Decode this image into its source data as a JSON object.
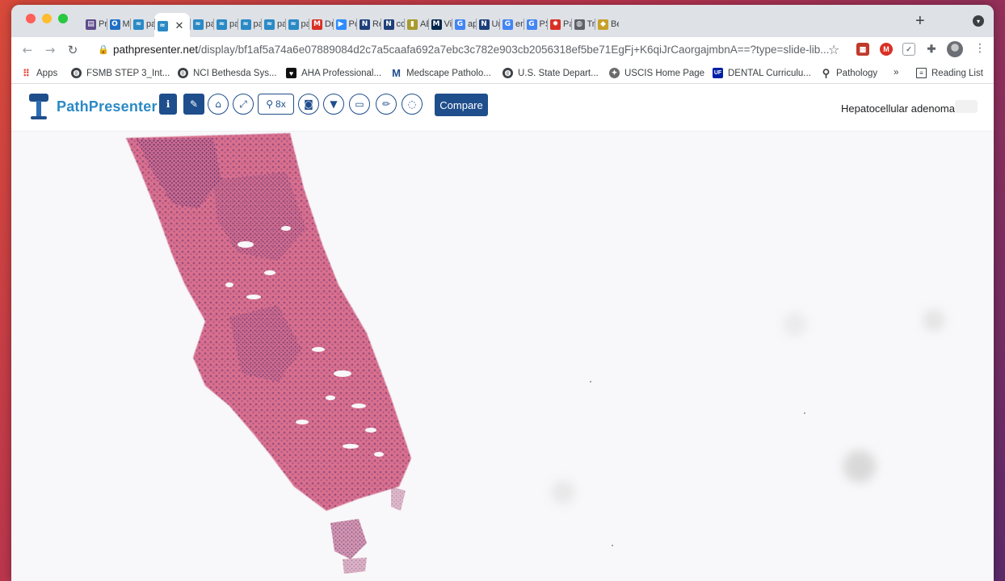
{
  "browser": {
    "tabs": [
      {
        "label": "Pr",
        "icon": "sidebar-tab-icon",
        "color": "#5f4b8b"
      },
      {
        "label": "M:",
        "icon": "outlook-icon",
        "color": "#1f6fc5"
      },
      {
        "label": "pa",
        "icon": "pathpresenter-icon",
        "color": "#2a8ac6"
      },
      {
        "label": "",
        "icon": "pathpresenter-icon",
        "color": "#2a8ac6",
        "active": true
      },
      {
        "label": "pa",
        "icon": "pathpresenter-icon",
        "color": "#2a8ac6"
      },
      {
        "label": "pa",
        "icon": "pathpresenter-icon",
        "color": "#2a8ac6"
      },
      {
        "label": "pa",
        "icon": "pathpresenter-icon",
        "color": "#2a8ac6"
      },
      {
        "label": "pa",
        "icon": "pathpresenter-icon",
        "color": "#2a8ac6"
      },
      {
        "label": "pa",
        "icon": "pathpresenter-icon",
        "color": "#2a8ac6"
      },
      {
        "label": "Dr",
        "icon": "gmail-icon",
        "color": "#d93025"
      },
      {
        "label": "Pc",
        "icon": "zoom-icon",
        "color": "#2d8cff"
      },
      {
        "label": "Re",
        "icon": "journal-icon",
        "color": "#1f3f7a"
      },
      {
        "label": "cc",
        "icon": "journal-icon",
        "color": "#1f3f7a"
      },
      {
        "label": "AE",
        "icon": "book-icon",
        "color": "#a89a2c"
      },
      {
        "label": "Vi",
        "icon": "michigan-icon",
        "color": "#00274c"
      },
      {
        "label": "ap",
        "icon": "google-icon",
        "color": "#4285f4"
      },
      {
        "label": "Ur",
        "icon": "journal-icon",
        "color": "#1f3f7a"
      },
      {
        "label": "en",
        "icon": "google-icon",
        "color": "#4285f4"
      },
      {
        "label": "PS",
        "icon": "google-icon",
        "color": "#4285f4"
      },
      {
        "label": "Pa",
        "icon": "gear-red-icon",
        "color": "#d93025"
      },
      {
        "label": "Tr",
        "icon": "globe-icon",
        "color": "#5f6368"
      },
      {
        "label": "Be",
        "icon": "tag-icon",
        "color": "#c7a02b"
      }
    ],
    "url_host": "pathpresenter.net",
    "url_path": "/display/bf1af5a74a6e07889084d2c7a5caafa692a7ebc3c782e903cb2056318ef5be71EgFj+K6qiJrCaorgajmbnA==?type=slide-lib...",
    "bookmarks": [
      {
        "label": "Apps",
        "icon": "apps-grid-icon"
      },
      {
        "label": "FSMB STEP 3_Int...",
        "icon": "globe-icon"
      },
      {
        "label": "NCI Bethesda Sys...",
        "icon": "globe-icon"
      },
      {
        "label": "AHA Professional...",
        "icon": "aha-icon"
      },
      {
        "label": "Medscape Patholo...",
        "icon": "medscape-icon"
      },
      {
        "label": "U.S. State Depart...",
        "icon": "globe-icon"
      },
      {
        "label": "USCIS Home Page",
        "icon": "seal-icon"
      },
      {
        "label": "DENTAL Curriculu...",
        "icon": "uf-icon"
      },
      {
        "label": "Pathology",
        "icon": "person-icon"
      }
    ],
    "more_bookmarks": "»",
    "reading_list": "Reading List"
  },
  "app": {
    "brand": "PathPresenter",
    "zoom_label": "8x",
    "compare_label": "Compare",
    "slide_title": "Hepatocellular adenoma",
    "colors": {
      "primary": "#1f4e8c",
      "brand_text": "#2a8ac6"
    }
  }
}
